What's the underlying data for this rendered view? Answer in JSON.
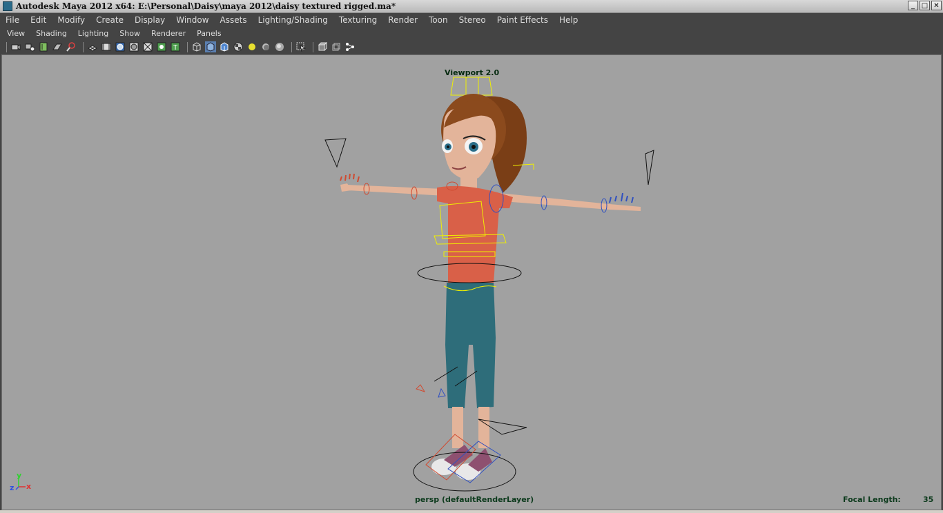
{
  "window": {
    "title": "Autodesk Maya 2012 x64: E:\\Personal\\Daisy\\maya 2012\\daisy textured rigged.ma*",
    "controls": {
      "minimize": "_",
      "maximize": "□",
      "close": "✕"
    }
  },
  "menubar": {
    "items": [
      "File",
      "Edit",
      "Modify",
      "Create",
      "Display",
      "Window",
      "Assets",
      "Lighting/Shading",
      "Texturing",
      "Render",
      "Toon",
      "Stereo",
      "Paint Effects",
      "Help"
    ]
  },
  "panel_menu": {
    "items": [
      "View",
      "Shading",
      "Lighting",
      "Show",
      "Renderer",
      "Panels"
    ]
  },
  "toolbar": {
    "icons": [
      "select-camera",
      "camera-attributes",
      "bookmarks",
      "image-plane",
      "2d-pan-zoom",
      "grid",
      "film-gate",
      "resolution-gate",
      "gate-mask",
      "field-chart",
      "safe-action",
      "safe-title",
      "wireframe",
      "smooth-shade-all",
      "wireframe-on-shaded",
      "textured",
      "use-all-lights",
      "shadows",
      "ambient-occlusion",
      "isolate-select",
      "xray",
      "xray-joints",
      "high-quality"
    ]
  },
  "viewport": {
    "renderer_label": "Viewport 2.0",
    "camera_label": "persp (defaultRenderLayer)",
    "focal_length_label": "Focal Length:",
    "focal_length_value": "35",
    "axis": {
      "y": "y",
      "z": "z",
      "x": "x"
    },
    "colors": {
      "background": "#a1a1a1",
      "hud_text": "#0c3a1c",
      "axis_y": "#2fd22f",
      "axis_x": "#e03030",
      "axis_z": "#3050e0"
    }
  }
}
